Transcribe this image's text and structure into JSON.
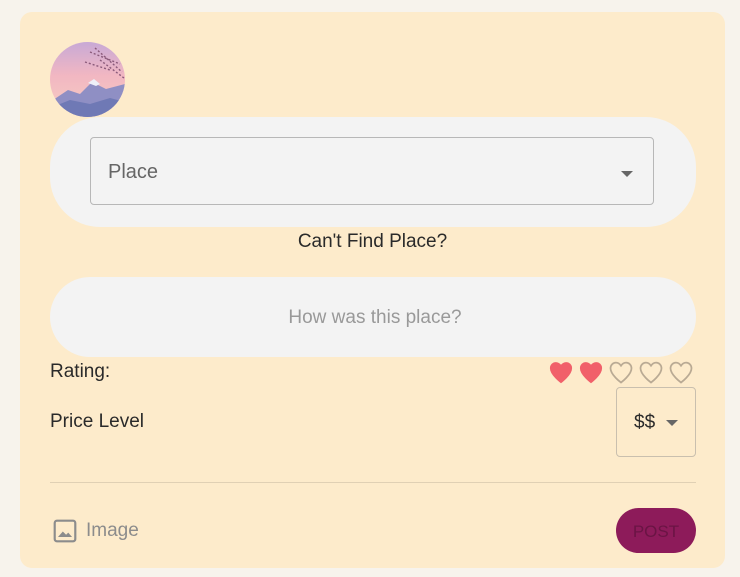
{
  "place": {
    "label": "Place"
  },
  "cant_find": "Can't Find Place?",
  "review": {
    "placeholder": "How was this place?",
    "value": ""
  },
  "rating": {
    "label": "Rating:",
    "value": 2,
    "max": 5,
    "icon": "heart-icon",
    "filled_color": "#f1606a",
    "empty_color": "#b9aa94"
  },
  "price": {
    "label": "Price Level",
    "value": "$$"
  },
  "image": {
    "label": "Image",
    "icon": "image-icon"
  },
  "post": {
    "label": "POST",
    "color": "#8d1b5a"
  },
  "colors": {
    "page_bg": "#f7f3ec",
    "card_bg": "#fdebcb",
    "field_bg": "#f3f3f3"
  }
}
